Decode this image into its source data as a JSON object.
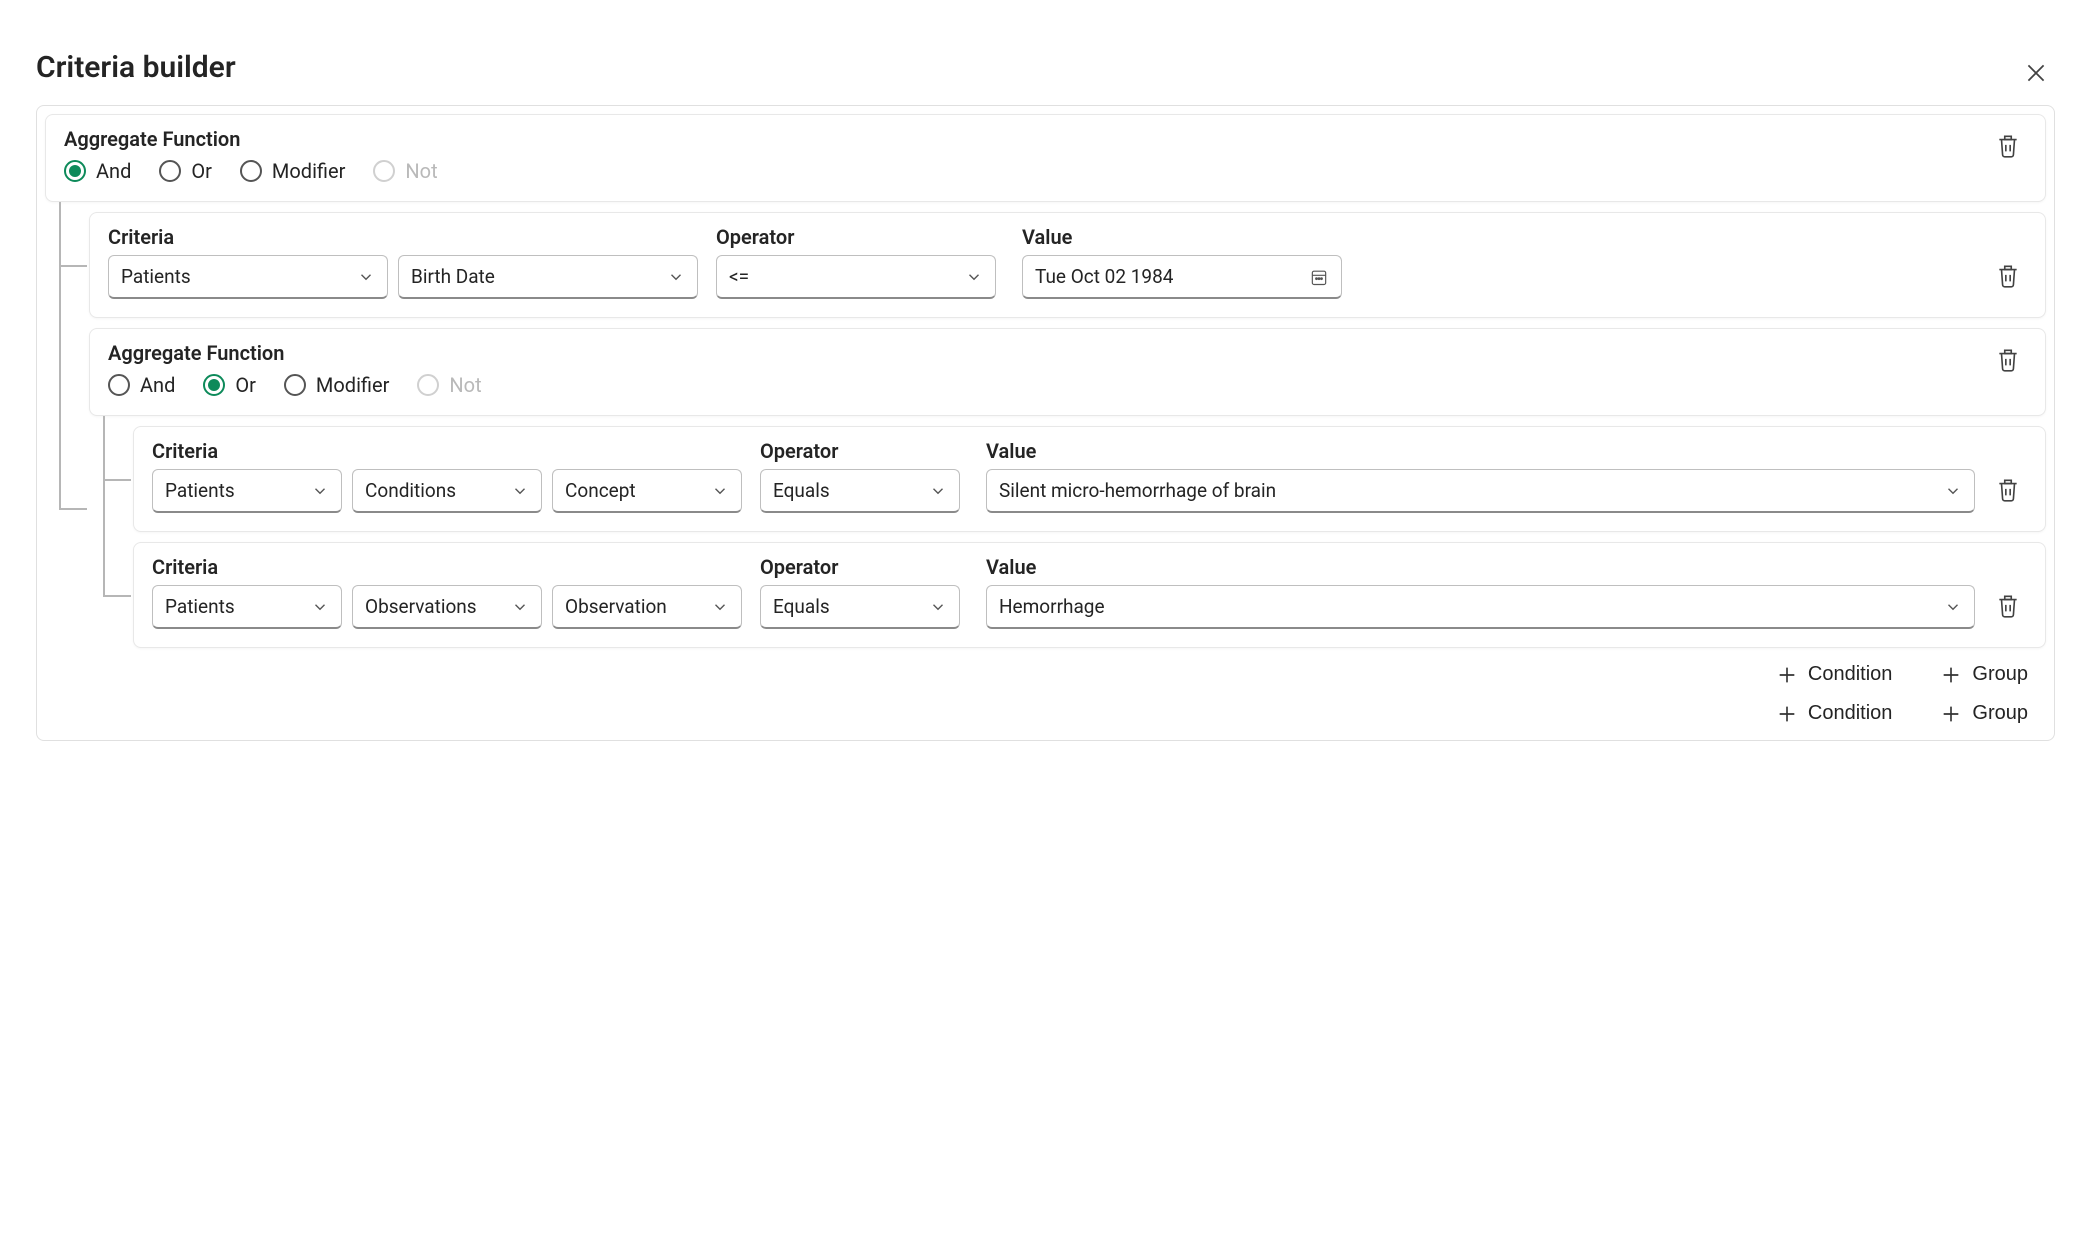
{
  "title": "Criteria builder",
  "labels": {
    "aggregate_function": "Aggregate Function",
    "criteria": "Criteria",
    "operator": "Operator",
    "value": "Value",
    "and": "And",
    "or": "Or",
    "modifier": "Modifier",
    "not": "Not",
    "condition": "Condition",
    "group": "Group"
  },
  "root": {
    "aggregate_selected": "and",
    "children": [
      {
        "type": "criteria",
        "criteria": [
          "Patients",
          "Birth Date"
        ],
        "operator": "<=",
        "value": "Tue Oct 02 1984",
        "value_kind": "date"
      },
      {
        "type": "group",
        "aggregate_selected": "or",
        "children": [
          {
            "type": "criteria",
            "criteria": [
              "Patients",
              "Conditions",
              "Concept"
            ],
            "operator": "Equals",
            "value": "Silent micro-hemorrhage of brain",
            "value_kind": "select"
          },
          {
            "type": "criteria",
            "criteria": [
              "Patients",
              "Observations",
              "Observation"
            ],
            "operator": "Equals",
            "value": "Hemorrhage",
            "value_kind": "select"
          }
        ]
      }
    ]
  }
}
